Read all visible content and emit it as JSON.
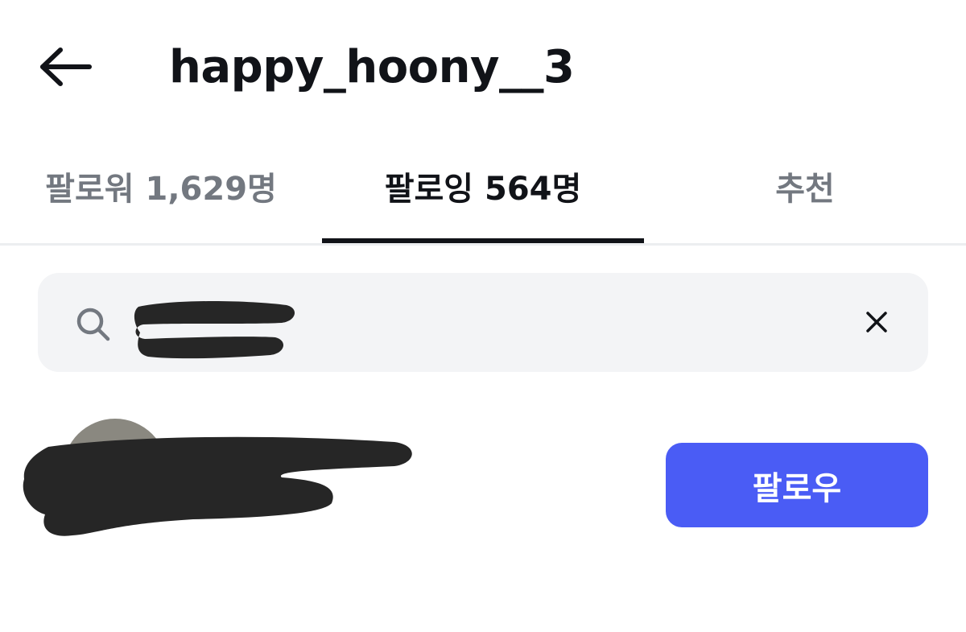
{
  "header": {
    "back_icon": "arrow-left-icon",
    "title": "happy_hoony__3"
  },
  "tabs": [
    {
      "label": "팔로워 1,629명",
      "active": false
    },
    {
      "label": "팔로잉 564명",
      "active": true
    },
    {
      "label": "추천",
      "active": false
    }
  ],
  "search": {
    "icon": "search-icon",
    "value": "",
    "clear_icon": "close-icon"
  },
  "list": {
    "items": [
      {
        "follow_label": "팔로우"
      }
    ]
  },
  "colors": {
    "primary": "#4a5cf5",
    "text": "#111318",
    "muted": "#737880",
    "search_bg": "#f3f4f6",
    "divider": "#eceef0"
  }
}
